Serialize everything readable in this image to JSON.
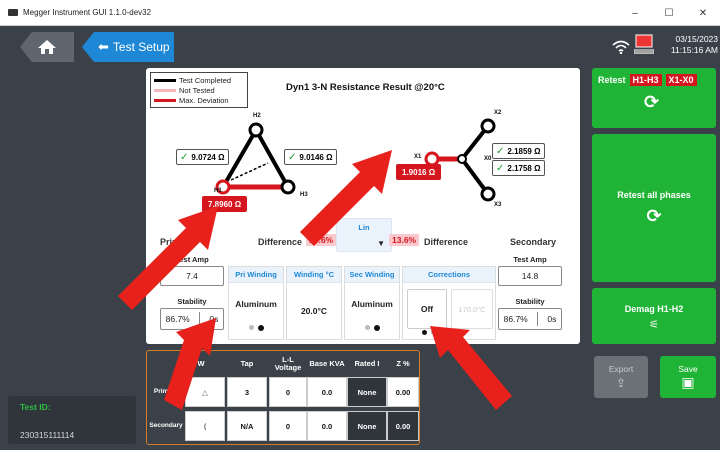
{
  "window": {
    "title": "Megger Instrument GUI 1.1.0-dev32",
    "controls": {
      "minimize": "–",
      "maximize": "☐",
      "close": "✕"
    }
  },
  "nav": {
    "home_icon": "home-icon",
    "breadcrumb": "Test Setup"
  },
  "status": {
    "date": "03/15/2023",
    "time": "11:15:16 AM",
    "icons": [
      "wifi-icon",
      "instrument-icon"
    ]
  },
  "result": {
    "title": "Dyn1 3-N Resistance Result @20°C",
    "legend": [
      {
        "label": "Test Completed",
        "color": "#000000"
      },
      {
        "label": "Not Tested",
        "color": "#f5b7bc"
      },
      {
        "label": "Max. Deviation",
        "color": "#d6161f"
      }
    ],
    "primary_nodes": {
      "h1": "H1",
      "h2": "H2",
      "h3": "H3"
    },
    "secondary_nodes": {
      "x0": "X0",
      "x1": "X1",
      "x2": "X2",
      "x3": "X3"
    },
    "primary_values": {
      "h1_h2": "9.0724 Ω",
      "h2_h3": "9.0146 Ω",
      "h1_h3": "7.8960 Ω"
    },
    "secondary_values": {
      "x2": "2.1859 Ω",
      "x3": "2.1758 Ω",
      "x1": "1.9016 Ω"
    }
  },
  "primary": {
    "label": "Primary",
    "diff_label": "Difference",
    "diff": "13.6%",
    "test_amp_label": "Test Amp",
    "test_amp": "7.4",
    "stability_label": "Stability",
    "stability": "86.7%",
    "stability_time": "0s"
  },
  "secondary": {
    "label": "Secondary",
    "diff_label": "Difference",
    "diff": "13.6%",
    "test_amp_label": "Test Amp",
    "test_amp": "14.8",
    "stability_label": "Stability",
    "stability": "86.7%",
    "stability_time": "0s"
  },
  "center_dropdown": {
    "label": "Lin"
  },
  "panels": {
    "pri_winding": {
      "header": "Pri Winding",
      "value": "Aluminum"
    },
    "winding_temp": {
      "header": "Winding °C",
      "value": "20.0°C"
    },
    "sec_winding": {
      "header": "Sec Winding",
      "value": "Aluminum"
    },
    "corrections": {
      "header": "Corrections",
      "value": "Off",
      "temp": "170.0°C"
    }
  },
  "actions": {
    "retest_label": "Retest",
    "retest_primary": "H1-H3",
    "retest_secondary": "X1-X0",
    "retest_all": "Retest all phases",
    "demag": "Demag H1-H2",
    "export": "Export",
    "save": "Save"
  },
  "transformer_table": {
    "headers": [
      "W",
      "Tap",
      "L-L Voltage",
      "Base KVA",
      "Rated I",
      "Z %"
    ],
    "rows": [
      {
        "name": "Primary",
        "tap": "3",
        "voltage": "0",
        "kva": "0.0",
        "rated": "None",
        "z": "0.00"
      },
      {
        "name": "Secondary",
        "tap": "N/A",
        "voltage": "0",
        "kva": "0.0",
        "rated": "None",
        "z": "0.00"
      }
    ]
  },
  "test_id": {
    "label": "Test ID:",
    "value": "230315111114"
  }
}
